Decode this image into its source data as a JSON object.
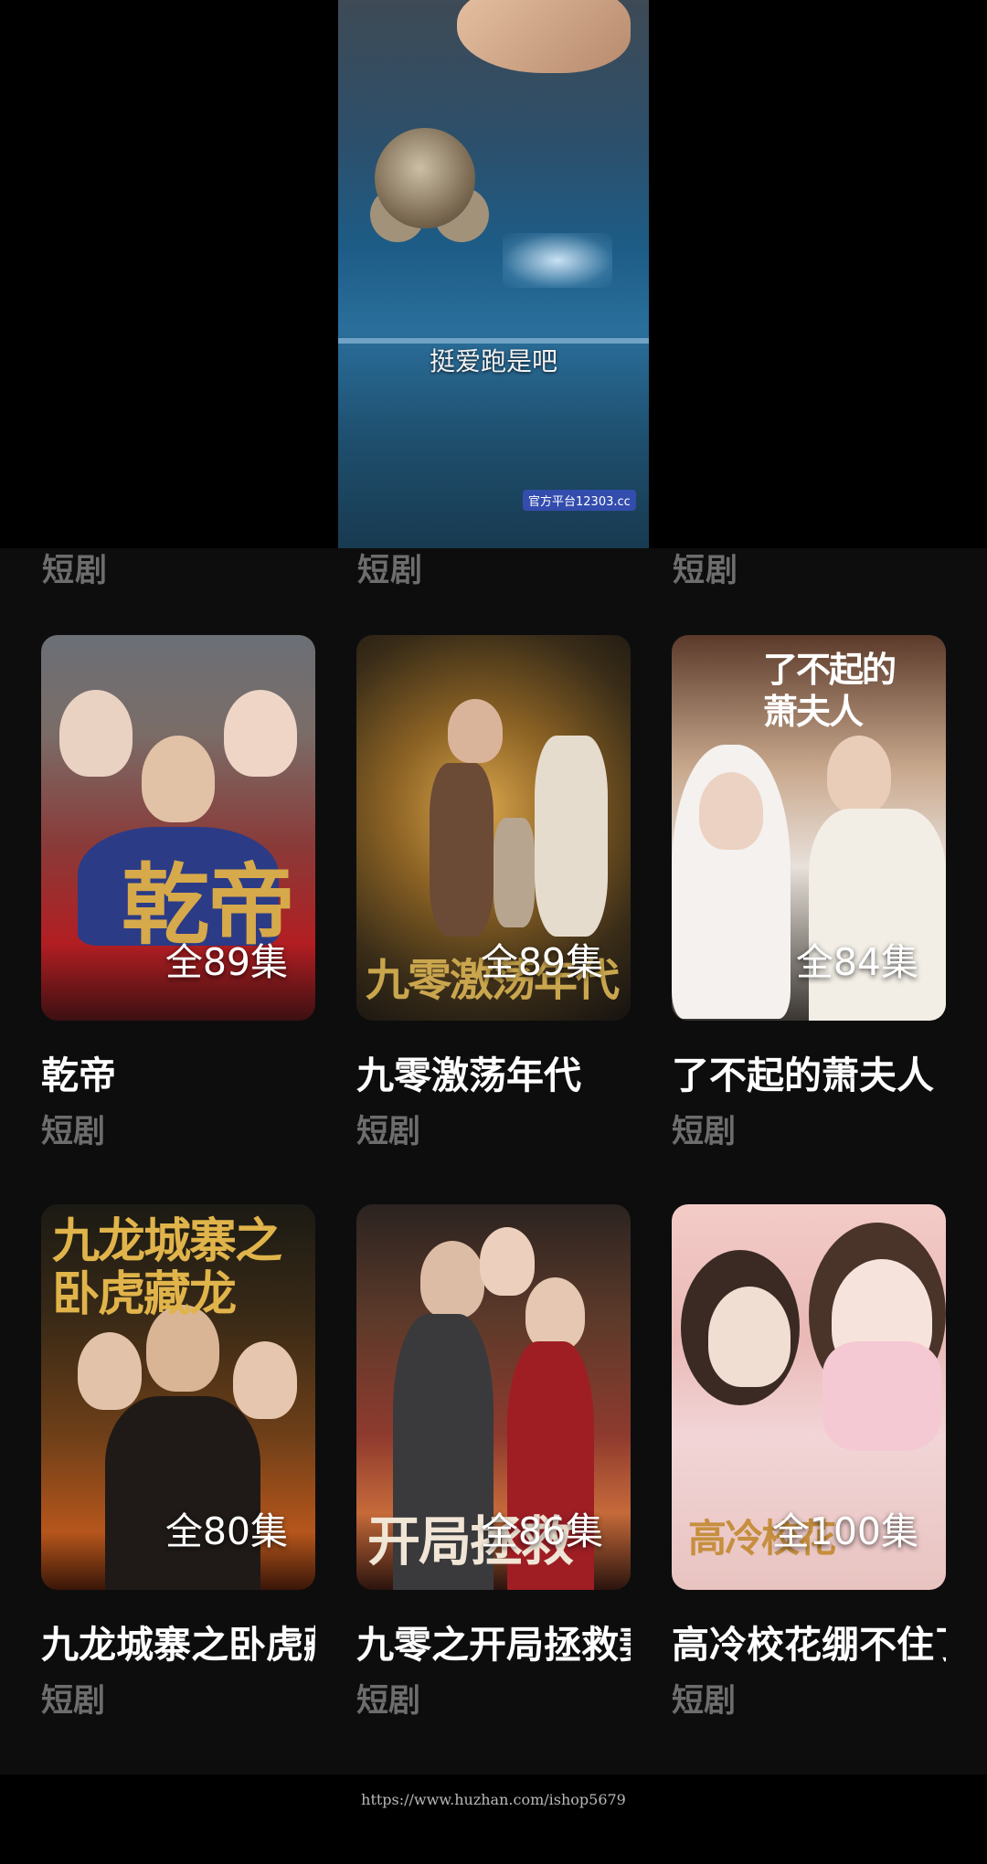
{
  "video": {
    "caption": "挺爱跑是吧",
    "watermark": "官方平台12303.cc"
  },
  "top_row_tags": [
    "短剧",
    "短剧",
    "短剧"
  ],
  "items": [
    {
      "title": "乾帝",
      "episodes": "全89集",
      "tag": "短剧",
      "poster_text": "乾帝"
    },
    {
      "title": "九零激荡年代",
      "episodes": "全89集",
      "tag": "短剧",
      "poster_text": "九零激荡年代"
    },
    {
      "title": "了不起的萧夫人",
      "episodes": "全84集",
      "tag": "短剧",
      "poster_text": "了不起的萧夫人"
    },
    {
      "title": "九龙城寨之卧虎藏龙",
      "episodes": "全80集",
      "tag": "短剧",
      "poster_text": "九龙城寨之卧虎藏龙"
    },
    {
      "title": "九零之开局拯救妻女",
      "episodes": "全86集",
      "tag": "短剧",
      "poster_text": "开局拯救"
    },
    {
      "title": "高冷校花绷不住了",
      "episodes": "全100集",
      "tag": "短剧",
      "poster_text": "高冷校花"
    }
  ],
  "footer": {
    "url": "https://www.huzhan.com/ishop5679"
  }
}
